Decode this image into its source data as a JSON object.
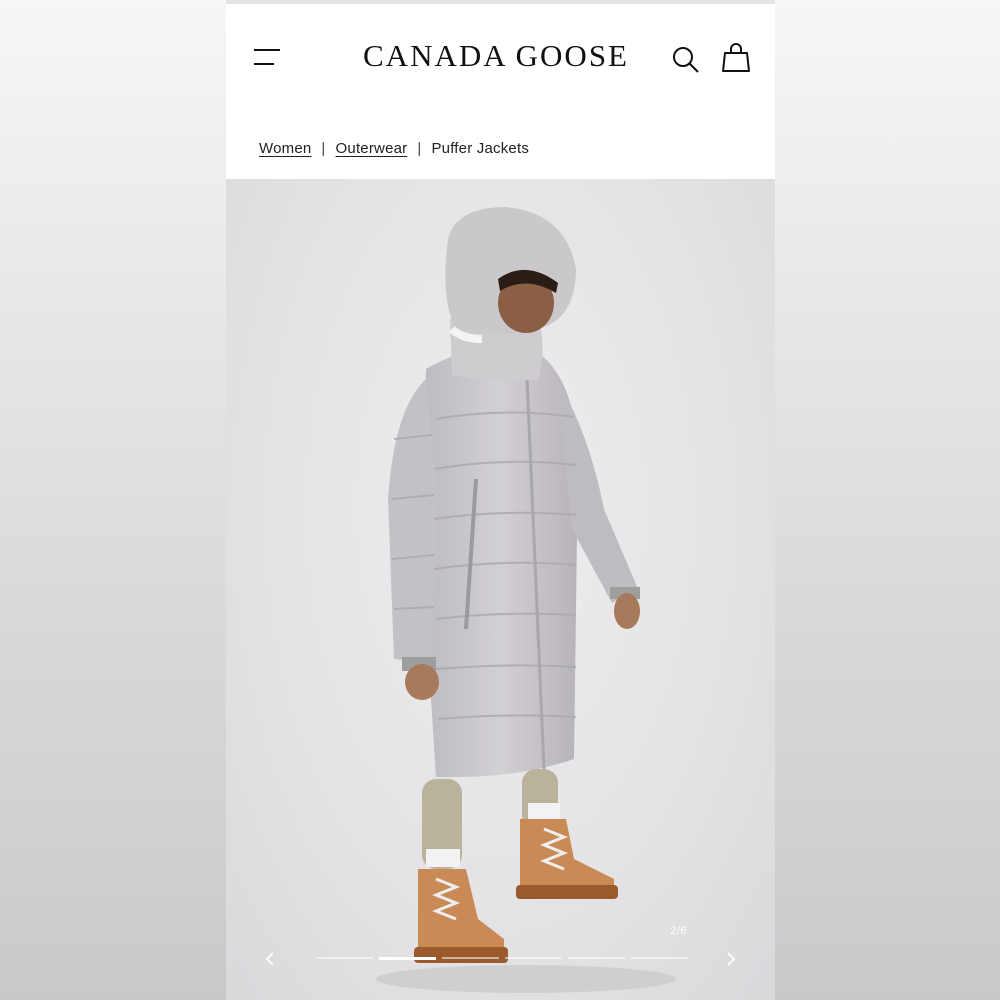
{
  "header": {
    "brand": "CANADA GOOSE",
    "menu_icon": "hamburger-menu-icon",
    "search_icon": "search-icon",
    "cart_icon": "shopping-bag-icon"
  },
  "breadcrumb": {
    "items": [
      "Women",
      "Outerwear",
      "Puffer Jackets"
    ],
    "separator": "|"
  },
  "gallery": {
    "counter": "2/6",
    "current_slide": 2,
    "total_slides": 6,
    "prev_icon": "chevron-left-icon",
    "next_icon": "chevron-right-icon"
  },
  "colors": {
    "page_bg": "#ffffff",
    "hero_bg": "#e4e4e6",
    "coat": "#c9c6ca",
    "boots": "#c98a55"
  }
}
